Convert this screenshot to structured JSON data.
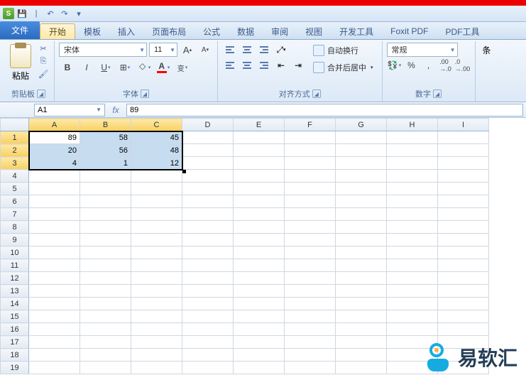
{
  "tabs": {
    "file": "文件",
    "items": [
      "开始",
      "模板",
      "插入",
      "页面布局",
      "公式",
      "数据",
      "审阅",
      "视图",
      "开发工具",
      "Foxit PDF",
      "PDF工具"
    ],
    "active_index": 0
  },
  "ribbon": {
    "clipboard": {
      "paste": "粘贴",
      "label": "剪贴板"
    },
    "font": {
      "name": "宋体",
      "size": "11",
      "label": "字体",
      "bold": "B",
      "italic": "I",
      "underline": "U",
      "grow": "A",
      "shrink": "A",
      "sup": "A",
      "subchg": "变"
    },
    "align": {
      "label": "对齐方式",
      "wrap": "自动换行",
      "merge": "合并后居中"
    },
    "number": {
      "format": "常规",
      "label": "数字",
      "percent": "%",
      "comma": ","
    },
    "cond": "条"
  },
  "namebox": {
    "ref": "A1",
    "fx": "fx",
    "formula": "89"
  },
  "sheet": {
    "cols": [
      "A",
      "B",
      "C",
      "D",
      "E",
      "F",
      "G",
      "H",
      "I"
    ],
    "sel_cols": 3,
    "sel_rows": 3,
    "rows": [
      {
        "n": 1,
        "cells": [
          "89",
          "58",
          "45",
          "",
          "",
          "",
          "",
          "",
          ""
        ]
      },
      {
        "n": 2,
        "cells": [
          "20",
          "56",
          "48",
          "",
          "",
          "",
          "",
          "",
          ""
        ]
      },
      {
        "n": 3,
        "cells": [
          "4",
          "1",
          "12",
          "",
          "",
          "",
          "",
          "",
          ""
        ]
      },
      {
        "n": 4,
        "cells": [
          "",
          "",
          "",
          "",
          "",
          "",
          "",
          "",
          ""
        ]
      },
      {
        "n": 5,
        "cells": [
          "",
          "",
          "",
          "",
          "",
          "",
          "",
          "",
          ""
        ]
      },
      {
        "n": 6,
        "cells": [
          "",
          "",
          "",
          "",
          "",
          "",
          "",
          "",
          ""
        ]
      },
      {
        "n": 7,
        "cells": [
          "",
          "",
          "",
          "",
          "",
          "",
          "",
          "",
          ""
        ]
      },
      {
        "n": 8,
        "cells": [
          "",
          "",
          "",
          "",
          "",
          "",
          "",
          "",
          ""
        ]
      },
      {
        "n": 9,
        "cells": [
          "",
          "",
          "",
          "",
          "",
          "",
          "",
          "",
          ""
        ]
      },
      {
        "n": 10,
        "cells": [
          "",
          "",
          "",
          "",
          "",
          "",
          "",
          "",
          ""
        ]
      },
      {
        "n": 11,
        "cells": [
          "",
          "",
          "",
          "",
          "",
          "",
          "",
          "",
          ""
        ]
      },
      {
        "n": 12,
        "cells": [
          "",
          "",
          "",
          "",
          "",
          "",
          "",
          "",
          ""
        ]
      },
      {
        "n": 13,
        "cells": [
          "",
          "",
          "",
          "",
          "",
          "",
          "",
          "",
          ""
        ]
      },
      {
        "n": 14,
        "cells": [
          "",
          "",
          "",
          "",
          "",
          "",
          "",
          "",
          ""
        ]
      },
      {
        "n": 15,
        "cells": [
          "",
          "",
          "",
          "",
          "",
          "",
          "",
          "",
          ""
        ]
      },
      {
        "n": 16,
        "cells": [
          "",
          "",
          "",
          "",
          "",
          "",
          "",
          "",
          ""
        ]
      },
      {
        "n": 17,
        "cells": [
          "",
          "",
          "",
          "",
          "",
          "",
          "",
          "",
          ""
        ]
      },
      {
        "n": 18,
        "cells": [
          "",
          "",
          "",
          "",
          "",
          "",
          "",
          "",
          ""
        ]
      },
      {
        "n": 19,
        "cells": [
          "",
          "",
          "",
          "",
          "",
          "",
          "",
          "",
          ""
        ]
      }
    ]
  },
  "chart_data": {
    "type": "table",
    "columns": [
      "A",
      "B",
      "C"
    ],
    "rows": [
      [
        89,
        58,
        45
      ],
      [
        20,
        56,
        48
      ],
      [
        4,
        1,
        12
      ]
    ]
  },
  "watermark": "易软汇",
  "colors": {
    "fill": "#ffff00",
    "font": "#ff0000"
  }
}
